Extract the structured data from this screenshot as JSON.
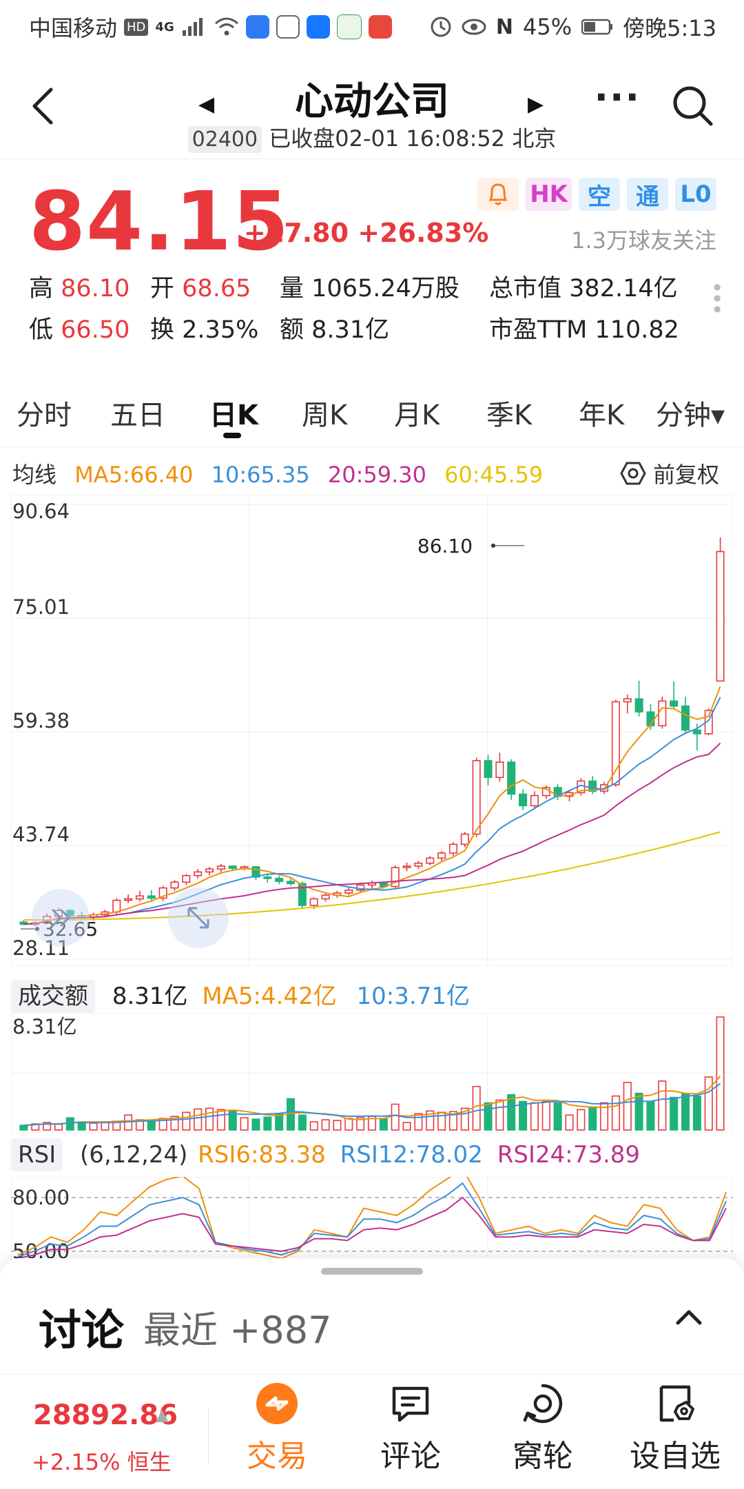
{
  "status": {
    "carrier": "中国移动",
    "hd": "HD",
    "net": "4G",
    "nfc": "N",
    "battery": "45%",
    "time": "傍晚5:13"
  },
  "header": {
    "title": "心动公司",
    "code": "02400",
    "market_status": "已收盘02-01 16:08:52 北京"
  },
  "quote": {
    "price": "84.15",
    "change": "+17.80 +26.83%",
    "badges": [
      "HK",
      "空",
      "通",
      "L0"
    ],
    "followers": "1.3万球友关注",
    "stats": [
      {
        "label": "高",
        "value": "86.10",
        "color": "red"
      },
      {
        "label": "开",
        "value": "68.65",
        "color": "red"
      },
      {
        "label": "量",
        "value": "1065.24万股",
        "color": "plain"
      },
      {
        "label": "总市值",
        "value": "382.14亿",
        "color": "plain"
      },
      {
        "label": "低",
        "value": "66.50",
        "color": "red"
      },
      {
        "label": "换",
        "value": "2.35%",
        "color": "plain"
      },
      {
        "label": "额",
        "value": "8.31亿",
        "color": "plain"
      },
      {
        "label": "市盈TTM",
        "value": "110.82",
        "color": "plain"
      }
    ]
  },
  "tabs": [
    "分时",
    "五日",
    "日K",
    "周K",
    "月K",
    "季K",
    "年K",
    "分钟▾"
  ],
  "active_tab": "日K",
  "ma_legend": {
    "label": "均线",
    "ma5": "MA5:66.40",
    "ma10": "10:65.35",
    "ma20": "20:59.30",
    "ma60": "60:45.59",
    "adjust": "前复权"
  },
  "colors": {
    "up": "#e8383d",
    "down": "#1fb37a",
    "ma5": "#f0900a",
    "ma10": "#3a8fd9",
    "ma20": "#c0308f",
    "ma60": "#e6c200",
    "accent": "#ff7a1a"
  },
  "chart_data": {
    "type": "candlestick",
    "y_axis_labels": [
      "90.64",
      "75.01",
      "59.38",
      "43.74",
      "28.11"
    ],
    "ylim": [
      28.11,
      90.64
    ],
    "max_marker": "86.10",
    "min_marker": "32.65",
    "candles": [
      [
        33.2,
        33.5,
        32.8,
        32.9
      ],
      [
        32.9,
        33.3,
        32.7,
        33.1
      ],
      [
        33.1,
        34.4,
        32.9,
        34.0
      ],
      [
        34.0,
        35.2,
        33.6,
        34.8
      ],
      [
        34.8,
        35.0,
        33.8,
        34.1
      ],
      [
        34.1,
        34.6,
        33.5,
        33.9
      ],
      [
        33.9,
        34.5,
        33.4,
        34.2
      ],
      [
        34.2,
        34.9,
        33.9,
        34.6
      ],
      [
        34.6,
        36.5,
        34.3,
        36.2
      ],
      [
        36.2,
        37.0,
        35.8,
        36.4
      ],
      [
        36.4,
        37.5,
        36.0,
        36.8
      ],
      [
        36.8,
        37.6,
        36.2,
        36.5
      ],
      [
        36.5,
        38.2,
        36.1,
        37.9
      ],
      [
        37.9,
        39.0,
        37.5,
        38.7
      ],
      [
        38.7,
        39.8,
        38.3,
        39.6
      ],
      [
        39.6,
        40.5,
        39.2,
        40.1
      ],
      [
        40.1,
        40.8,
        39.6,
        40.5
      ],
      [
        40.5,
        41.2,
        40.0,
        40.9
      ],
      [
        40.9,
        41.0,
        40.2,
        40.6
      ],
      [
        40.6,
        41.0,
        40.3,
        40.8
      ],
      [
        40.8,
        40.9,
        39.0,
        39.4
      ],
      [
        39.4,
        39.9,
        38.6,
        39.2
      ],
      [
        39.2,
        39.6,
        38.4,
        38.8
      ],
      [
        38.8,
        39.4,
        38.2,
        38.5
      ],
      [
        38.5,
        38.8,
        35.1,
        35.5
      ],
      [
        35.5,
        36.6,
        35.0,
        36.4
      ],
      [
        36.4,
        37.2,
        36.0,
        36.9
      ],
      [
        36.9,
        37.5,
        36.5,
        37.2
      ],
      [
        37.2,
        38.0,
        36.9,
        37.6
      ],
      [
        37.6,
        38.6,
        37.3,
        38.3
      ],
      [
        38.3,
        38.9,
        37.8,
        38.6
      ],
      [
        38.6,
        38.8,
        37.8,
        38.1
      ],
      [
        38.1,
        41.0,
        37.9,
        40.7
      ],
      [
        40.7,
        41.4,
        40.2,
        40.9
      ],
      [
        40.9,
        41.6,
        40.5,
        41.3
      ],
      [
        41.3,
        42.3,
        41.0,
        42.0
      ],
      [
        42.0,
        43.0,
        41.6,
        42.7
      ],
      [
        42.7,
        44.2,
        42.3,
        43.9
      ],
      [
        43.9,
        45.6,
        43.5,
        45.3
      ],
      [
        45.3,
        55.8,
        44.9,
        55.4
      ],
      [
        55.4,
        56.2,
        52.0,
        53.1
      ],
      [
        53.1,
        56.5,
        52.5,
        55.2
      ],
      [
        55.2,
        55.6,
        50.0,
        50.8
      ],
      [
        50.8,
        51.5,
        48.6,
        49.2
      ],
      [
        49.2,
        51.2,
        48.8,
        50.6
      ],
      [
        50.6,
        52.0,
        50.1,
        51.7
      ],
      [
        51.7,
        52.2,
        50.0,
        50.5
      ],
      [
        50.5,
        51.4,
        49.8,
        51.0
      ],
      [
        51.0,
        53.0,
        50.6,
        52.6
      ],
      [
        52.6,
        53.3,
        50.8,
        51.2
      ],
      [
        51.2,
        52.5,
        50.8,
        52.1
      ],
      [
        52.1,
        63.8,
        51.8,
        63.5
      ],
      [
        63.5,
        64.5,
        61.9,
        63.9
      ],
      [
        63.9,
        66.4,
        61.5,
        62.1
      ],
      [
        62.1,
        63.2,
        59.6,
        60.2
      ],
      [
        60.2,
        64.2,
        59.8,
        63.6
      ],
      [
        63.6,
        66.3,
        62.5,
        62.9
      ],
      [
        62.9,
        64.2,
        59.1,
        59.6
      ],
      [
        59.6,
        60.5,
        56.8,
        59.1
      ],
      [
        59.1,
        62.6,
        58.9,
        62.3
      ],
      [
        66.35,
        86.1,
        66.5,
        84.15
      ]
    ]
  },
  "volume": {
    "label": "成交额",
    "value": "8.31亿",
    "ma5": "MA5:4.42亿",
    "ma10": "10:3.71亿",
    "axis_top": "8.31亿"
  },
  "volume_data": [
    0.35,
    0.45,
    0.55,
    0.42,
    0.9,
    0.6,
    0.5,
    0.55,
    0.65,
    1.1,
    0.75,
    0.7,
    0.85,
    1.0,
    1.3,
    1.55,
    1.6,
    1.5,
    1.4,
    0.9,
    0.8,
    0.95,
    1.2,
    2.3,
    1.1,
    0.6,
    0.75,
    0.7,
    0.85,
    0.9,
    1.0,
    0.8,
    1.9,
    0.55,
    1.2,
    1.4,
    1.3,
    1.35,
    1.6,
    3.2,
    2.0,
    2.2,
    2.6,
    2.1,
    2.0,
    2.1,
    2.0,
    1.1,
    1.5,
    1.7,
    2.0,
    2.5,
    3.5,
    2.7,
    2.1,
    3.6,
    2.4,
    2.7,
    2.5,
    3.9,
    8.31
  ],
  "rsi": {
    "label": "RSI",
    "params": "(6,12,24)",
    "rsi6": "RSI6:83.38",
    "rsi12": "RSI12:78.02",
    "rsi24": "RSI24:73.89",
    "axis": [
      "80.00",
      "50.00"
    ]
  },
  "rsi_data": {
    "rsi6": [
      48,
      52,
      58,
      55,
      62,
      72,
      70,
      78,
      86,
      90,
      92,
      85,
      55,
      52,
      50,
      48,
      46,
      50,
      62,
      60,
      58,
      74,
      72,
      70,
      76,
      84,
      90,
      96,
      80,
      60,
      62,
      64,
      60,
      62,
      60,
      70,
      66,
      64,
      76,
      74,
      62,
      56,
      58,
      83
    ],
    "rsi12": [
      47,
      50,
      54,
      53,
      58,
      64,
      64,
      70,
      76,
      78,
      80,
      76,
      55,
      53,
      51,
      50,
      48,
      51,
      60,
      59,
      58,
      68,
      68,
      66,
      70,
      76,
      81,
      88,
      74,
      59,
      60,
      61,
      59,
      60,
      59,
      66,
      63,
      62,
      70,
      68,
      60,
      56,
      57,
      78
    ],
    "rsi24": [
      46,
      48,
      51,
      51,
      54,
      58,
      59,
      63,
      67,
      69,
      71,
      69,
      54,
      53,
      52,
      51,
      50,
      52,
      57,
      57,
      56,
      62,
      63,
      62,
      65,
      69,
      73,
      80,
      70,
      58,
      58,
      59,
      58,
      58,
      58,
      62,
      61,
      60,
      65,
      64,
      59,
      56,
      56,
      74
    ]
  },
  "discuss": {
    "title": "讨论",
    "subtitle": "最近 +887"
  },
  "bottom": {
    "index_value": "28892.86",
    "index_change": "+2.15% 恒生",
    "nav": [
      "交易",
      "评论",
      "窝轮",
      "设自选"
    ]
  }
}
